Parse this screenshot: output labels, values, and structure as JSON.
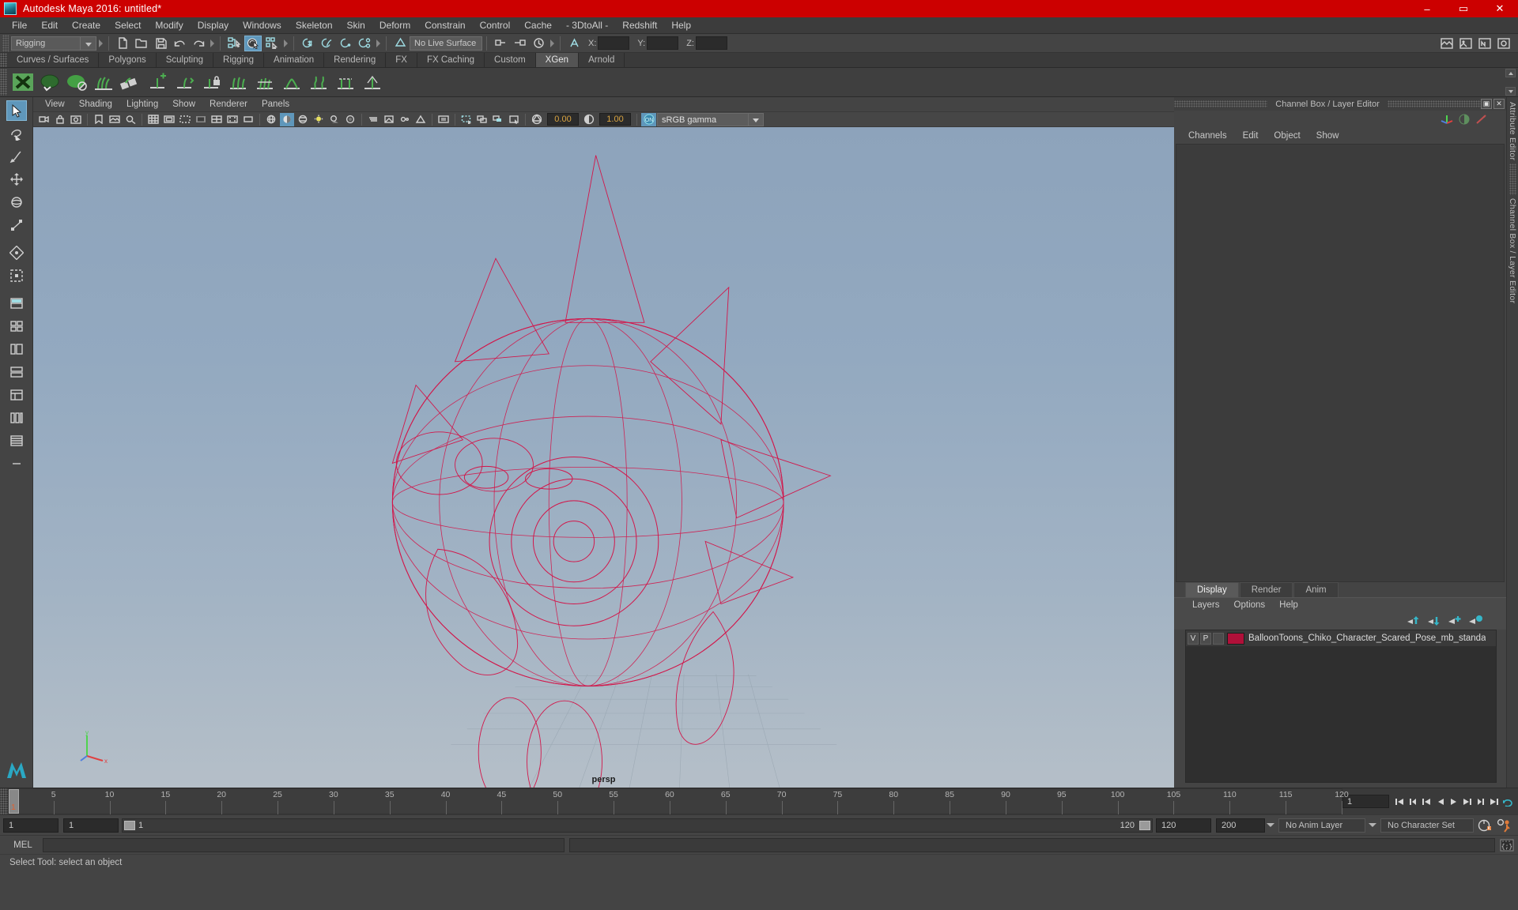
{
  "window": {
    "title": "Autodesk Maya 2016: untitled*",
    "logo_icon": "maya-logo-icon",
    "controls": {
      "minimize": "–",
      "maximize": "▭",
      "close": "✕"
    },
    "titlebar_color": "#cc0000"
  },
  "menubar": {
    "items": [
      "File",
      "Edit",
      "Create",
      "Select",
      "Modify",
      "Display",
      "Windows",
      "Skeleton",
      "Skin",
      "Deform",
      "Constrain",
      "Control",
      "Cache",
      "- 3DtoAll -",
      "Redshift",
      "Help"
    ]
  },
  "toolbar": {
    "menuset": "Rigging",
    "coord_labels": {
      "x": "X:",
      "y": "Y:",
      "z": "Z:"
    },
    "coord_values": {
      "x": "",
      "y": "",
      "z": ""
    },
    "live_surface": "No Live Surface",
    "icons": [
      "new-scene-icon",
      "open-scene-icon",
      "save-scene-icon",
      "undo-icon",
      "redo-icon",
      "select-by-hierarchy-icon",
      "select-by-object-icon",
      "select-by-component-icon",
      "snap-to-grid-icon",
      "snap-to-curve-icon",
      "snap-to-point-icon",
      "snap-to-projected-center-icon",
      "snap-to-view-plane-icon",
      "make-live-icon",
      "render-view-icon",
      "render-current-frame-icon",
      "ipr-render-icon",
      "render-settings-icon"
    ]
  },
  "shelf": {
    "tabs": [
      "Curves / Surfaces",
      "Polygons",
      "Sculpting",
      "Rigging",
      "Animation",
      "Rendering",
      "FX",
      "FX Caching",
      "Custom",
      "XGen",
      "Arnold"
    ],
    "selected_tab": "XGen",
    "icons": [
      "xgen-window-icon",
      "xgen-create-description-icon",
      "xgen-create-collection-icon",
      "xgen-groom-icon",
      "xgen-guide-icon",
      "xgen-add-guide-icon",
      "xgen-move-guide-icon",
      "xgen-lock-guide-icon",
      "xgen-part-icon",
      "xgen-density-icon",
      "xgen-clump-icon",
      "xgen-noise-icon",
      "xgen-cut-icon",
      "xgen-region-icon"
    ]
  },
  "left_tools": {
    "items": [
      "select-tool-icon",
      "lasso-select-tool-icon",
      "paint-select-tool-icon",
      "move-tool-icon",
      "rotate-tool-icon",
      "scale-tool-icon",
      "universal-manipulator-icon",
      "soft-modification-icon",
      "last-tool-icon",
      "single-perspective-view-icon",
      "four-view-layout-icon",
      "outliner-persp-layout-icon",
      "persp-graph-layout-icon",
      "hypershade-persp-layout-icon",
      "hypergraph-layout-icon",
      "outliner-layout-icon",
      "minus-layout-icon"
    ]
  },
  "viewport": {
    "menus": [
      "View",
      "Shading",
      "Lighting",
      "Show",
      "Renderer",
      "Panels"
    ],
    "toolbar_icons": [
      "select-camera-icon",
      "lock-camera-icon",
      "camera-attributes-icon",
      "bookmarks-icon",
      "image-plane-icon",
      "two-d-pan-zoom-icon",
      "grid-icon",
      "film-gate-icon",
      "resolution-gate-icon",
      "gate-mask-icon",
      "field-chart-icon",
      "safe-action-icon",
      "safe-title-icon",
      "wireframe-icon",
      "smooth-shade-icon",
      "shaded-textured-icon",
      "use-all-lights-icon",
      "shadows-icon",
      "screen-space-ao-icon",
      "motion-blur-icon",
      "multisample-icon",
      "depth-of-field-icon",
      "isolate-select-icon",
      "xray-icon",
      "xray-joints-icon",
      "xray-active-components-icon",
      "exposure-icon",
      "gamma-icon"
    ],
    "exposure_value": "0.00",
    "gamma_value": "1.00",
    "color_space": "sRGB gamma",
    "color_management_enabled": "ON",
    "camera_label": "persp",
    "axis_labels": {
      "x": "x",
      "y": "y",
      "z": "z"
    },
    "model_color": "#d2164a",
    "background_top": "#8da3bb",
    "background_bottom": "#b5bfc8"
  },
  "right_dock": {
    "panel_title": "Channel Box / Layer Editor",
    "window_buttons": {
      "undock": "▣",
      "close": "✕"
    },
    "channel_menus": [
      "Channels",
      "Edit",
      "Object",
      "Show"
    ],
    "header_icons": [
      "show-manipulators-icon",
      "channel-box-icon",
      "attribute-editor-icon"
    ],
    "vertical_labels": [
      "Attribute Editor",
      "Channel Box / Layer Editor"
    ]
  },
  "layer_editor": {
    "tabs": [
      "Display",
      "Render",
      "Anim"
    ],
    "selected_tab": "Display",
    "menus": [
      "Layers",
      "Options",
      "Help"
    ],
    "buttons": [
      "move-layer-up-icon",
      "move-layer-down-icon",
      "create-new-layer-icon",
      "create-layer-from-selected-icon"
    ],
    "layers": [
      {
        "visibility": "V",
        "playback": "P",
        "third": "",
        "color": "#b01039",
        "name": "BalloonToons_Chiko_Character_Scared_Pose_mb_standa"
      }
    ]
  },
  "timeline": {
    "start": 1,
    "end": 120,
    "current_frame": "1",
    "tick_step": 5,
    "labels": [
      "5",
      "10",
      "15",
      "20",
      "25",
      "30",
      "35",
      "40",
      "45",
      "50",
      "55",
      "60",
      "65",
      "70",
      "75",
      "80",
      "85",
      "90",
      "95",
      "100",
      "105",
      "110",
      "115",
      "120"
    ],
    "current_frame_field": "1",
    "playback_buttons": [
      "go-to-start-icon",
      "step-back-keyframe-icon",
      "step-back-frame-icon",
      "play-backwards-icon",
      "play-forwards-icon",
      "step-forward-frame-icon",
      "step-forward-keyframe-icon",
      "go-to-end-icon"
    ]
  },
  "range_slider": {
    "anim_start": "1",
    "range_start": "1",
    "bar_start_label": "1",
    "bar_end_label": "120",
    "range_end": "120",
    "anim_end": "200",
    "anim_layer": "No Anim Layer",
    "character_set": "No Character Set",
    "auto_key_icon": "auto-keyframe-icon",
    "anim_prefs_icon": "animation-preferences-icon"
  },
  "command_line": {
    "label": "MEL",
    "input_value": "",
    "output_value": "",
    "script_editor_icon": "script-editor-icon"
  },
  "status_bar": {
    "message": "Select Tool: select an object"
  }
}
